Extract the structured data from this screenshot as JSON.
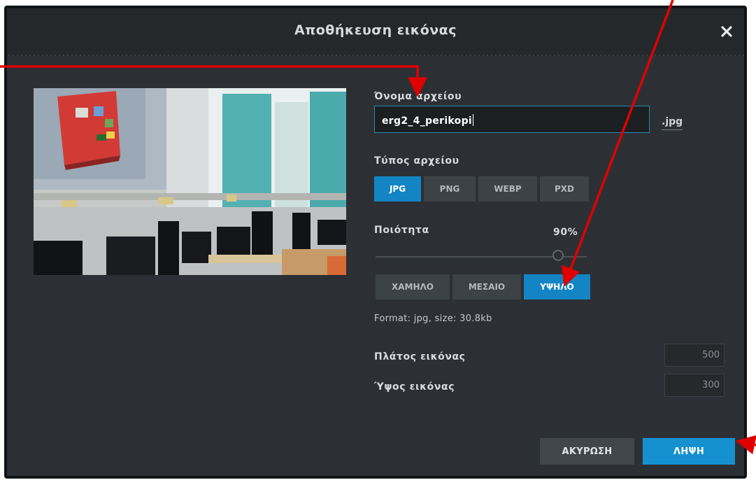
{
  "dialog": {
    "title": "Αποθήκευση εικόνας",
    "close_icon": "close-icon"
  },
  "form": {
    "filename_label": "Όνομα αρχείου",
    "filename_value": "erg2_4_perikopi",
    "extension": ".jpg",
    "filetype_label": "Τύπος αρχείου",
    "filetypes": [
      "JPG",
      "PNG",
      "WEBP",
      "PXD"
    ],
    "selected_filetype": "JPG",
    "quality_label": "Ποιότητα",
    "quality_value": "90%",
    "quality_fraction": 0.9,
    "quality_presets": [
      "ΧΑΜΗΛΟ",
      "ΜΕΣΑΙΟ",
      "ΥΨΗΛΟ"
    ],
    "selected_preset": "ΥΨΗΛΟ",
    "format_info": "Format: jpg, size: 30.8kb",
    "width_label": "Πλάτος εικόνας",
    "width_value": "500",
    "height_label": "Ύψος εικόνας",
    "height_value": "300"
  },
  "buttons": {
    "cancel": "ΑΚΥΡΩΣΗ",
    "download": "ΛΗΨΗ"
  },
  "colors": {
    "accent": "#1385c4",
    "dialog_bg": "#2c3034",
    "annotation_arrow": "#e00000"
  }
}
